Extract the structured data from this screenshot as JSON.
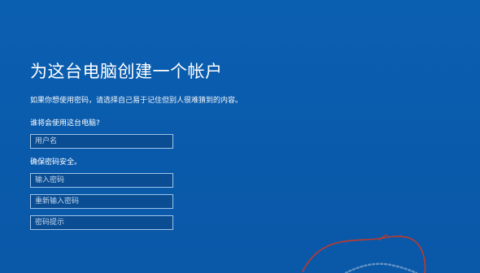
{
  "setup": {
    "title": "为这台电脑创建一个帐户",
    "description": "如果你想使用密码，请选择自己易于记住但别人很难猜到的内容。",
    "who_label": "谁将会使用这台电脑?",
    "username_placeholder": "用户名",
    "secure_label": "确保密码安全。",
    "password_placeholder": "输入密码",
    "reenter_placeholder": "重新输入密码",
    "hint_placeholder": "密码提示"
  },
  "colors": {
    "background": "#0a5cad",
    "field_background": "#0a4d93",
    "field_border": "#9fc3e8",
    "annotation": "#c0392b"
  }
}
